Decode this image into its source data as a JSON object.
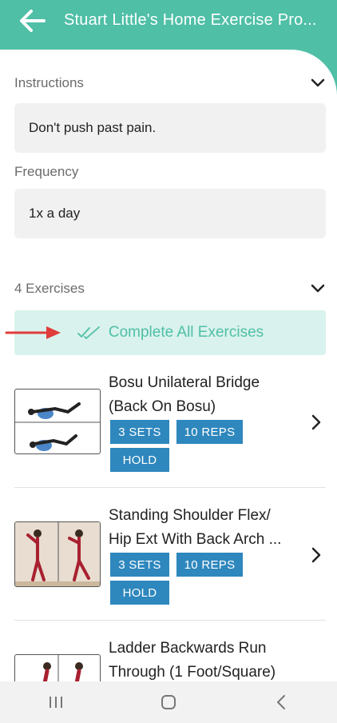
{
  "header": {
    "title": "Stuart Little's Home Exercise Pro...",
    "back_icon": "arrow-left-icon",
    "color": "#4fbfa6"
  },
  "instructions": {
    "label": "Instructions",
    "value": "Don't push past pain."
  },
  "frequency": {
    "label": "Frequency",
    "value": "1x a day"
  },
  "exercises_section": {
    "label": "4 Exercises",
    "complete_all_label": "Complete All Exercises"
  },
  "exercises": [
    {
      "name_line1": "Bosu Unilateral Bridge",
      "name_line2": "(Back On Bosu)",
      "sets": "3 SETS",
      "reps": "10 REPS",
      "hold": "HOLD"
    },
    {
      "name_line1": "Standing Shoulder Flex/",
      "name_line2": "Hip Ext With Back Arch ...",
      "sets": "3 SETS",
      "reps": "10 REPS",
      "hold": "HOLD"
    },
    {
      "name_line1": "Ladder Backwards Run",
      "name_line2": "Through (1 Foot/Square)"
    }
  ],
  "colors": {
    "accent": "#4fbfa6",
    "tag": "#2e87bd",
    "complete_bg": "#d9f2ed",
    "annotation_arrow": "#e03c3c"
  },
  "navbar": {
    "icons": [
      "recent-apps-icon",
      "home-icon",
      "back-icon"
    ]
  }
}
